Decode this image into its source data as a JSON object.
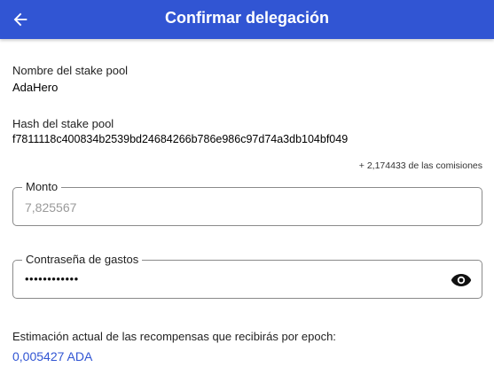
{
  "header": {
    "title": "Confirmar delegación",
    "back_icon": "arrow-left-icon",
    "color": "#3155d3"
  },
  "pool": {
    "name_label": "Nombre del stake pool",
    "name_value": "AdaHero",
    "hash_label": "Hash del stake pool",
    "hash_value": "f7811118c400834b2539bd24684266b786e986c97d74a3db104bf049"
  },
  "fees": {
    "text": "+ 2,174433 de las comisiones"
  },
  "amount": {
    "label": "Monto",
    "value": "7,825567"
  },
  "password": {
    "label": "Contraseña de gastos",
    "masked_value": "••••••••••••",
    "visibility_icon": "eye-icon"
  },
  "rewards": {
    "label": "Estimación actual de las recompensas que recibirás por epoch:",
    "value": "0,005427 ADA",
    "color": "#3155d3"
  }
}
